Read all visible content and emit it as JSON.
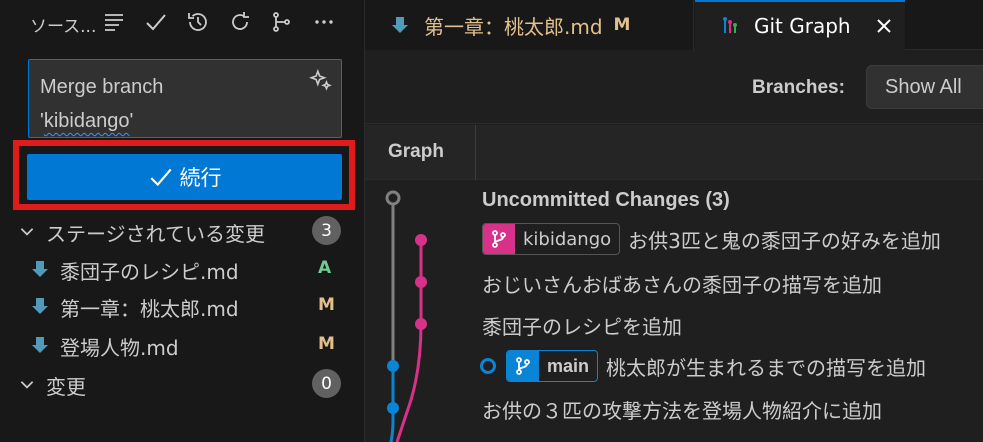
{
  "scm": {
    "title": "ソース...",
    "commit_message_line1": "Merge branch",
    "commit_message_prefix": "'",
    "commit_message_branch": "kibidango",
    "commit_message_suffix": "'",
    "commit_button_label": "続行",
    "staged_label": "ステージされている変更",
    "staged_count": "3",
    "changes_label": "変更",
    "changes_count": "0",
    "files": [
      {
        "name": "黍団子のレシピ.md",
        "status": "A",
        "status_color": "#73c991"
      },
      {
        "name": "第一章：桃太郎.md",
        "status": "M",
        "status_color": "#e2c08d"
      },
      {
        "name": "登場人物.md",
        "status": "M",
        "status_color": "#e2c08d"
      }
    ],
    "toolbar_icons": [
      "view-as-tree-icon",
      "commit-check-icon",
      "history-icon",
      "refresh-icon",
      "branch-graph-icon",
      "more-icon"
    ]
  },
  "tabs": {
    "story_label": "第一章：桃太郎.md",
    "story_status": "M",
    "graph_label": "Git Graph"
  },
  "graph": {
    "branches_label": "Branches:",
    "branches_value": "Show All",
    "column_header": "Graph",
    "rows": {
      "uncommitted": "Uncommitted Changes (3)",
      "kibidango_ref": "kibidango",
      "kibidango_msg": "お供3匹と鬼の黍団子の好みを追加",
      "row3": "おじいさんおばあさんの黍団子の描写を追加",
      "row4": "黍団子のレシピを追加",
      "main_ref": "main",
      "main_msg": "桃太郎が生まれるまでの描写を追加",
      "row6": "お供の３匹の攻撃方法を登場人物紹介に追加"
    },
    "colors": {
      "main": "#0a84d4",
      "branch": "#d8318a",
      "uncommitted": "#808080"
    }
  }
}
